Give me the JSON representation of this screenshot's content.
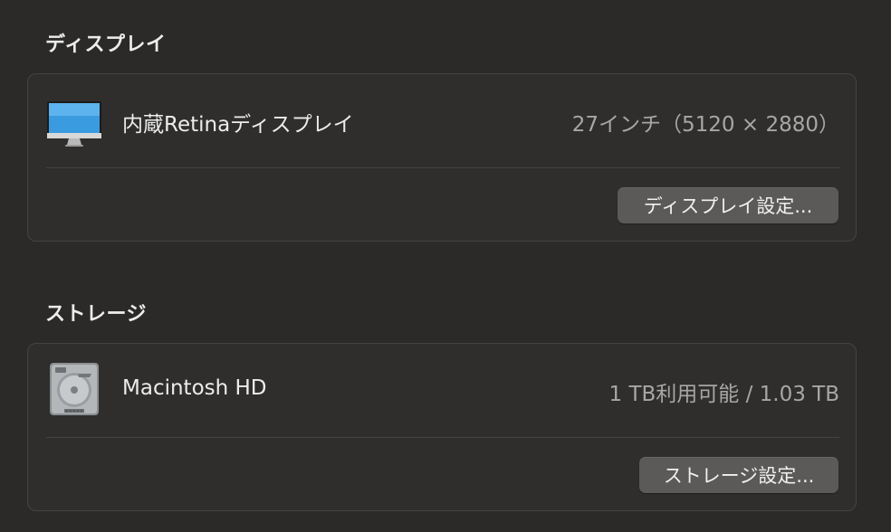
{
  "display_section": {
    "title": "ディスプレイ",
    "item": {
      "icon": "imac-display-icon",
      "name": "内蔵Retinaディスプレイ",
      "value": "27インチ（5120 × 2880）"
    },
    "button_label": "ディスプレイ設定..."
  },
  "storage_section": {
    "title": "ストレージ",
    "item": {
      "icon": "hard-drive-icon",
      "name": "Macintosh HD",
      "value": "1 TB利用可能 / 1.03 TB"
    },
    "button_label": "ストレージ設定..."
  },
  "colors": {
    "background": "#2b2a29",
    "card": "#2f2e2d",
    "button": "#5b5a59",
    "secondary_text": "#a8a7a5"
  }
}
